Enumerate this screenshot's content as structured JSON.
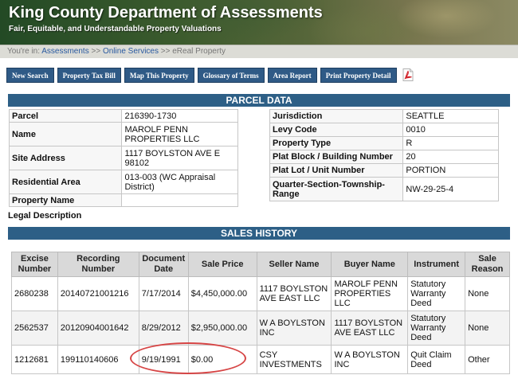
{
  "header": {
    "title": "King County Department of Assessments",
    "subtitle": "Fair, Equitable, and Understandable Property Valuations"
  },
  "breadcrumb": {
    "lead": "You're in:",
    "items": [
      "Assessments",
      "Online Services",
      "eReal Property"
    ],
    "separator": ">>"
  },
  "toolbar": {
    "buttons": [
      "New Search",
      "Property Tax Bill",
      "Map This Property",
      "Glossary of Terms",
      "Area Report",
      "Print Property Detail"
    ]
  },
  "parcel_data": {
    "heading": "PARCEL DATA",
    "left": [
      {
        "label": "Parcel",
        "value": "216390-1730"
      },
      {
        "label": "Name",
        "value": "MAROLF PENN PROPERTIES LLC"
      },
      {
        "label": "Site Address",
        "value": "1117 BOYLSTON AVE E 98102"
      },
      {
        "label": "Residential Area",
        "value": "013-003 (WC Appraisal District)"
      },
      {
        "label": "Property Name",
        "value": ""
      }
    ],
    "right": [
      {
        "label": "Jurisdiction",
        "value": "SEATTLE"
      },
      {
        "label": "Levy Code",
        "value": "0010"
      },
      {
        "label": "Property Type",
        "value": "R"
      },
      {
        "label": "Plat Block / Building Number",
        "value": "20"
      },
      {
        "label": "Plat Lot / Unit Number",
        "value": "PORTION"
      },
      {
        "label": "Quarter-Section-Township-Range",
        "value": "NW-29-25-4"
      }
    ],
    "legal_description_label": "Legal Description"
  },
  "sales_history": {
    "heading": "SALES HISTORY",
    "columns": [
      "Excise Number",
      "Recording Number",
      "Document Date",
      "Sale Price",
      "Seller Name",
      "Buyer Name",
      "Instrument",
      "Sale Reason"
    ],
    "rows": [
      {
        "excise": "2680238",
        "recording": "20140721001216",
        "date": "7/17/2014",
        "price": "$4,450,000.00",
        "seller": "1117 BOYLSTON AVE EAST LLC",
        "buyer": "MAROLF PENN PROPERTIES LLC",
        "instrument": "Statutory Warranty Deed",
        "reason": "None"
      },
      {
        "excise": "2562537",
        "recording": "20120904001642",
        "date": "8/29/2012",
        "price": "$2,950,000.00",
        "seller": "W A BOYLSTON INC",
        "buyer": "1117 BOYLSTON AVE EAST LLC",
        "instrument": "Statutory Warranty Deed",
        "reason": "None"
      },
      {
        "excise": "1212681",
        "recording": "199110140606",
        "date": "9/19/1991",
        "price": "$0.00",
        "seller": "CSY INVESTMENTS",
        "buyer": "W A BOYLSTON INC",
        "instrument": "Quit Claim Deed",
        "reason": "Other"
      }
    ]
  },
  "icons": {
    "pdf": "pdf-file-icon"
  },
  "colors": {
    "section_header": "#2d5f86",
    "toolbar_button": "#2f5a86",
    "highlight": "#d64545"
  }
}
